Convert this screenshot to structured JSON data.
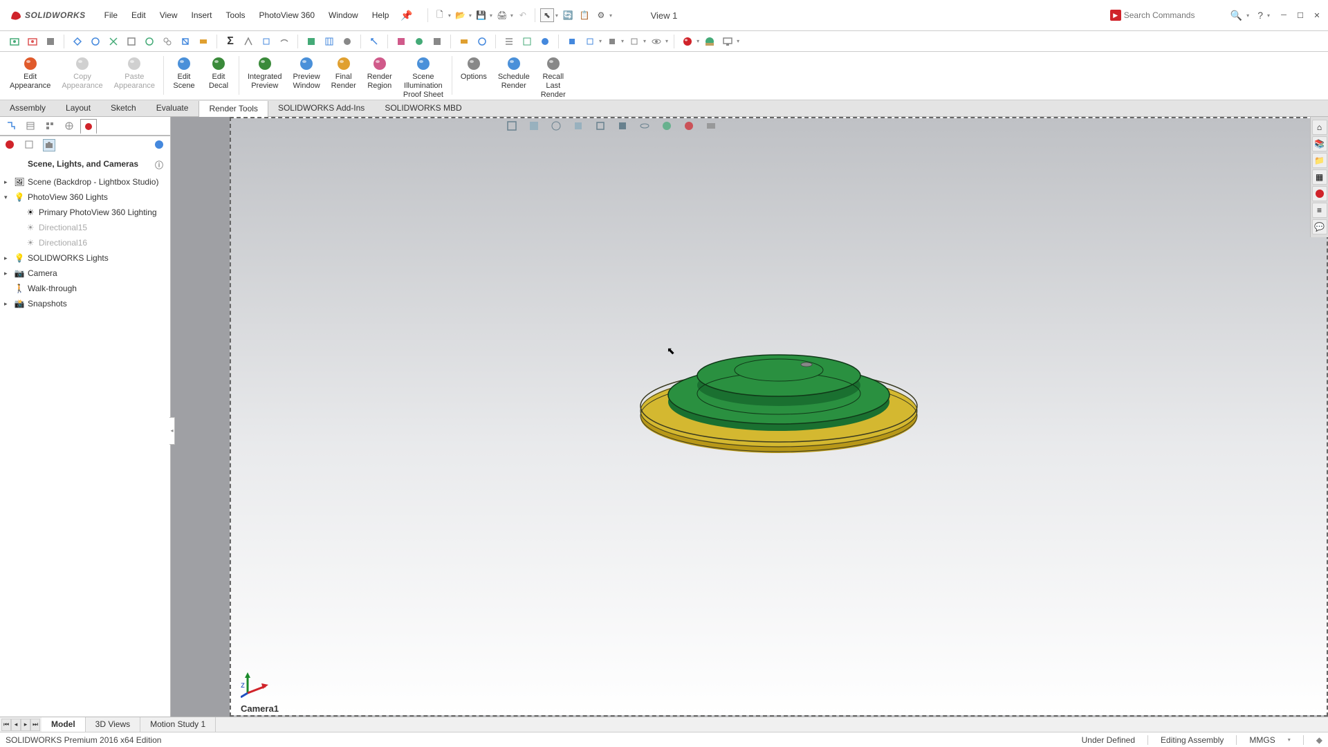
{
  "app": {
    "title": "SOLIDWORKS",
    "view_label": "View 1",
    "search_placeholder": "Search Commands"
  },
  "menus": [
    "File",
    "Edit",
    "View",
    "Insert",
    "Tools",
    "PhotoView 360",
    "Window",
    "Help"
  ],
  "ribbon": [
    {
      "label": "Edit\nAppearance",
      "disabled": false,
      "color": "#e05a2b"
    },
    {
      "label": "Copy\nAppearance",
      "disabled": true,
      "color": "#999"
    },
    {
      "label": "Paste\nAppearance",
      "disabled": true,
      "color": "#999"
    },
    {
      "label": "Edit\nScene",
      "disabled": false,
      "color": "#4a90d9"
    },
    {
      "label": "Edit\nDecal",
      "disabled": false,
      "color": "#3a8a3a"
    },
    {
      "label": "Integrated\nPreview",
      "disabled": false,
      "color": "#3a8a3a"
    },
    {
      "label": "Preview\nWindow",
      "disabled": false,
      "color": "#4a90d9"
    },
    {
      "label": "Final\nRender",
      "disabled": false,
      "color": "#e0a030"
    },
    {
      "label": "Render\nRegion",
      "disabled": false,
      "color": "#d05a8a"
    },
    {
      "label": "Scene\nIllumination\nProof Sheet",
      "disabled": false,
      "color": "#4a90d9"
    },
    {
      "label": "Options",
      "disabled": false,
      "color": "#888"
    },
    {
      "label": "Schedule\nRender",
      "disabled": false,
      "color": "#4a90d9"
    },
    {
      "label": "Recall\nLast\nRender",
      "disabled": false,
      "color": "#888"
    }
  ],
  "tabs": [
    "Assembly",
    "Layout",
    "Sketch",
    "Evaluate",
    "Render Tools",
    "SOLIDWORKS Add-Ins",
    "SOLIDWORKS MBD"
  ],
  "active_tab": "Render Tools",
  "panel": {
    "title": "Scene, Lights, and Cameras",
    "tree": [
      {
        "arrow": "▸",
        "icon": "scene",
        "label": "Scene (Backdrop - Lightbox Studio)",
        "indent": 0
      },
      {
        "arrow": "▾",
        "icon": "pv360",
        "label": "PhotoView 360 Lights",
        "indent": 0
      },
      {
        "arrow": "",
        "icon": "light",
        "label": "Primary PhotoView 360 Lighting",
        "indent": 1
      },
      {
        "arrow": "",
        "icon": "dirlight",
        "label": "Directional15",
        "indent": 1,
        "dim": true
      },
      {
        "arrow": "",
        "icon": "dirlight",
        "label": "Directional16",
        "indent": 1,
        "dim": true
      },
      {
        "arrow": "▸",
        "icon": "swlights",
        "label": "SOLIDWORKS Lights",
        "indent": 0
      },
      {
        "arrow": "▸",
        "icon": "camera",
        "label": "Camera",
        "indent": 0
      },
      {
        "arrow": "",
        "icon": "walk",
        "label": "Walk-through",
        "indent": 0
      },
      {
        "arrow": "▸",
        "icon": "snap",
        "label": "Snapshots",
        "indent": 0
      }
    ]
  },
  "viewport": {
    "camera_label": "Camera1"
  },
  "bottom_tabs": [
    "Model",
    "3D Views",
    "Motion Study 1"
  ],
  "active_bottom_tab": "Model",
  "status": {
    "left": "SOLIDWORKS Premium 2016 x64 Edition",
    "defined": "Under Defined",
    "mode": "Editing Assembly",
    "units": "MMGS"
  }
}
